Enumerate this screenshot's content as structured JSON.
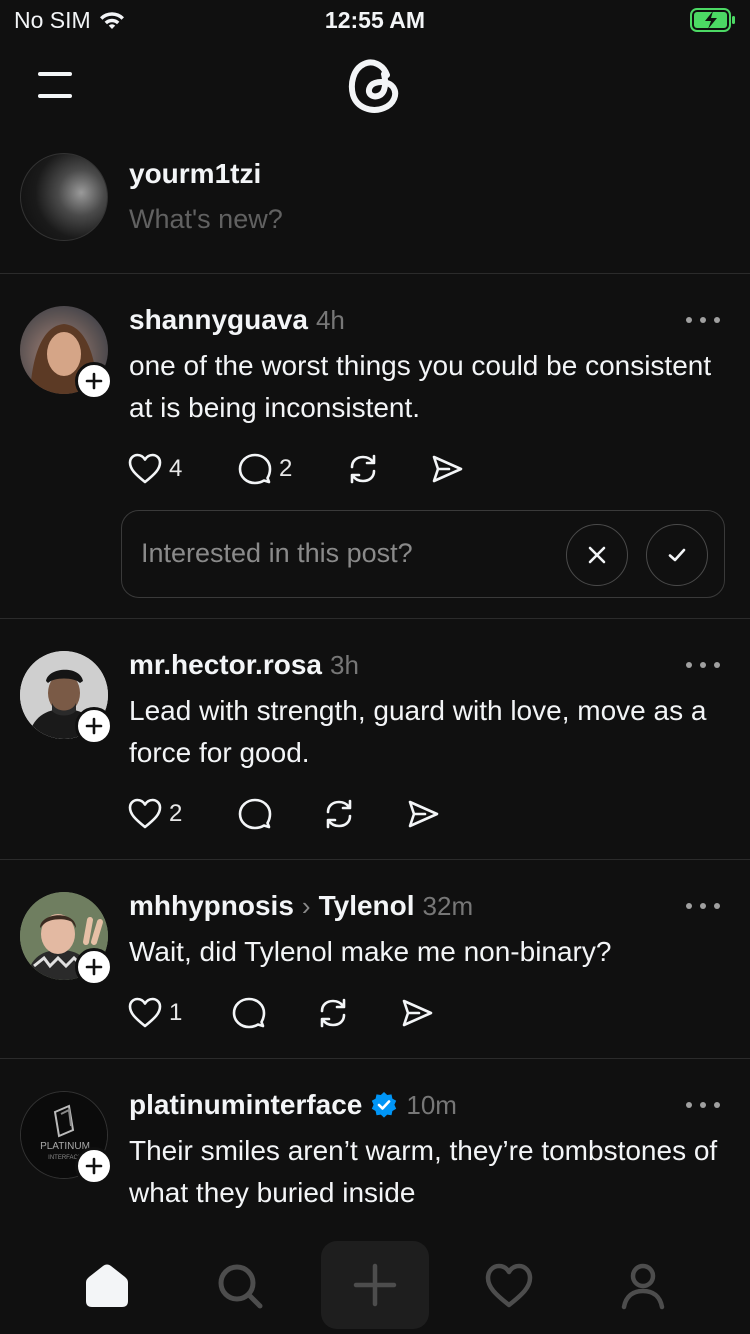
{
  "status_bar": {
    "carrier": "No SIM",
    "time": "12:55 AM"
  },
  "composer": {
    "username": "yourm1tzi",
    "placeholder": "What's new?"
  },
  "posts": [
    {
      "username": "shannyguava",
      "time": "4h",
      "text": "one of the worst things you could be consistent at is being inconsistent.",
      "likes": "4",
      "replies": "2",
      "interest_prompt": "Interested in this post?"
    },
    {
      "username": "mr.hector.rosa",
      "time": "3h",
      "text": "Lead with strength, guard with love, move as a force for good.",
      "likes": "2"
    },
    {
      "username": "mhhypnosis",
      "topic": "Tylenol",
      "time": "32m",
      "text": "Wait, did Tylenol make me non-binary?",
      "likes": "1"
    },
    {
      "username": "platinuminterface",
      "verified": true,
      "time": "10m",
      "text": "Their smiles aren’t warm, they’re tombstones of what they buried inside",
      "avatar_text": "PLATINUM INTERFACE"
    }
  ],
  "icons": {
    "menu": "menu-icon",
    "logo": "threads-logo-icon",
    "like": "heart-icon",
    "reply": "reply-bubble-icon",
    "repost": "repost-icon",
    "share": "send-icon",
    "home": "home-icon",
    "search": "search-icon",
    "create": "plus-icon",
    "activity": "heart-icon",
    "profile": "profile-icon"
  },
  "colors": {
    "background": "#101010",
    "text": "#f3f5f7",
    "muted": "#777777",
    "verified": "#0095f6",
    "battery": "#4cd964"
  }
}
